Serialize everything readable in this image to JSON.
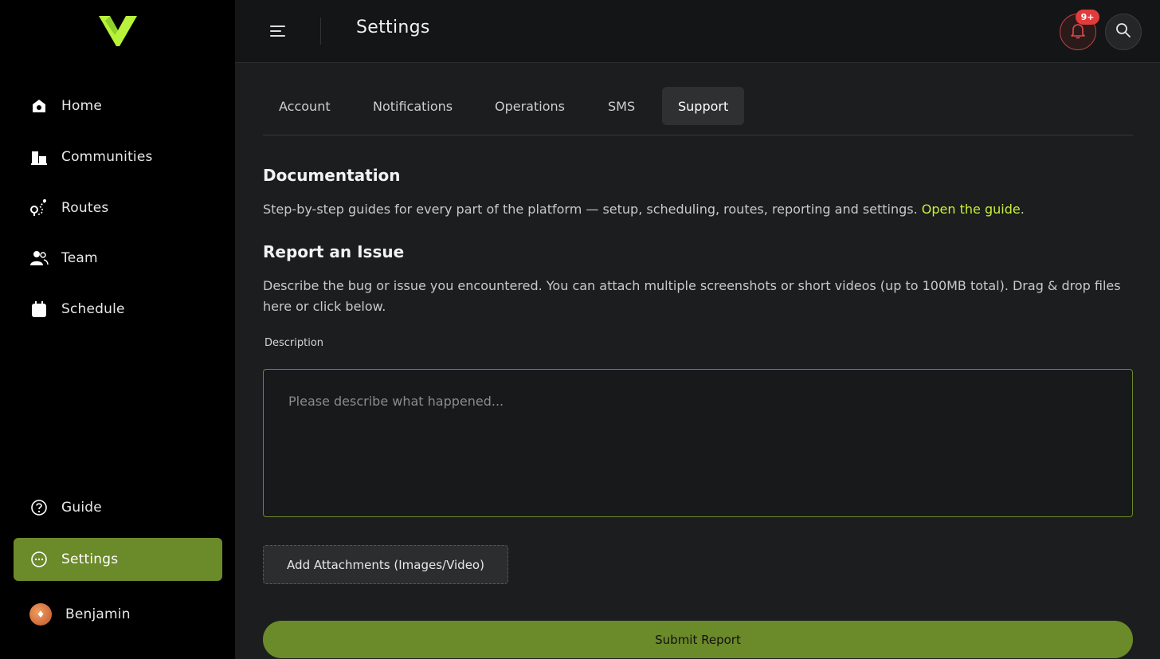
{
  "sidebar": {
    "logo": "logo-icon",
    "nav": [
      {
        "label": "Home",
        "icon": "home-icon"
      },
      {
        "label": "Communities",
        "icon": "buildings-icon"
      },
      {
        "label": "Routes",
        "icon": "route-icon"
      },
      {
        "label": "Team",
        "icon": "team-icon"
      },
      {
        "label": "Schedule",
        "icon": "calendar-icon"
      }
    ],
    "bottom": [
      {
        "label": "Guide",
        "icon": "help-circle-icon"
      },
      {
        "label": "Settings",
        "icon": "settings-icon",
        "active": true
      }
    ],
    "user": {
      "name": "Benjamin"
    }
  },
  "topbar": {
    "title": "Settings",
    "notification_badge": "9+"
  },
  "tabs": [
    {
      "label": "Account"
    },
    {
      "label": "Notifications"
    },
    {
      "label": "Operations"
    },
    {
      "label": "SMS"
    },
    {
      "label": "Support",
      "active": true
    }
  ],
  "documentation": {
    "heading": "Documentation",
    "text": "Step-by-step guides for every part of the platform — setup, scheduling, routes, reporting and settings. ",
    "link": "Open the guide",
    "after_link": "."
  },
  "report": {
    "heading": "Report an Issue",
    "text": "Describe the bug or issue you encountered. You can attach multiple screenshots or short videos (up to 100MB total). Drag & drop files here or click below.",
    "description_label": "Description",
    "description_placeholder": "Please describe what happened...",
    "description_value": "",
    "attach_label": "Add Attachments (Images/Video)",
    "submit_label": "Submit Report"
  },
  "colors": {
    "accent": "#6b8a2a",
    "link": "#c8ef3a",
    "badge": "#e13c3c"
  }
}
